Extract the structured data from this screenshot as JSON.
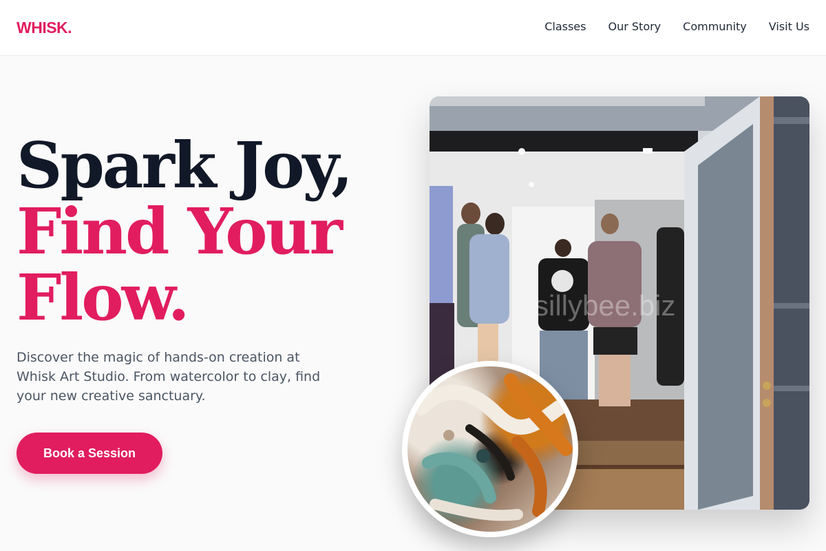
{
  "brand": {
    "logo": "WHISK.",
    "accent_color": "#e11d5f"
  },
  "nav": {
    "items": [
      {
        "label": "Classes"
      },
      {
        "label": "Our Story"
      },
      {
        "label": "Community"
      },
      {
        "label": "Visit Us"
      }
    ]
  },
  "hero": {
    "headline": {
      "line1": "Spark Joy,",
      "line2": "Find Your",
      "line3": "Flow."
    },
    "description": "Discover the magic of hands-on creation at Whisk Art Studio. From watercolor to clay, find your new creative sanctuary.",
    "cta_label": "Book a Session"
  },
  "images": {
    "main_photo": "studio-gallery-crowd-photo",
    "inset_photo": "paint-texture-closeup-photo",
    "watermark": "sillybee.biz"
  }
}
